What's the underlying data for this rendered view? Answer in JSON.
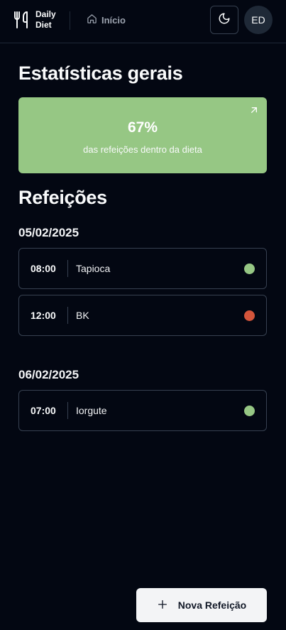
{
  "header": {
    "logo_line1": "Daily",
    "logo_line2": "Diet",
    "nav_home_label": "Início",
    "avatar_initials": "ED"
  },
  "stats": {
    "title": "Estatísticas gerais",
    "value": "67%",
    "label": "das refeições dentro da dieta",
    "card_color": "#96c784"
  },
  "meals": {
    "title": "Refeições",
    "groups": [
      {
        "date": "05/02/2025",
        "items": [
          {
            "time": "08:00",
            "name": "Tapioca",
            "in_diet": true
          },
          {
            "time": "12:00",
            "name": "BK",
            "in_diet": false
          }
        ]
      },
      {
        "date": "06/02/2025",
        "items": [
          {
            "time": "07:00",
            "name": "Iorgute",
            "in_diet": true
          }
        ]
      }
    ]
  },
  "status_colors": {
    "in_diet": "#96c784",
    "off_diet": "#d4553b"
  },
  "new_meal_button": {
    "label": "Nova Refeição"
  },
  "icons": [
    "utensils-icon",
    "home-icon",
    "moon-icon",
    "arrow-up-right-icon",
    "plus-icon"
  ]
}
